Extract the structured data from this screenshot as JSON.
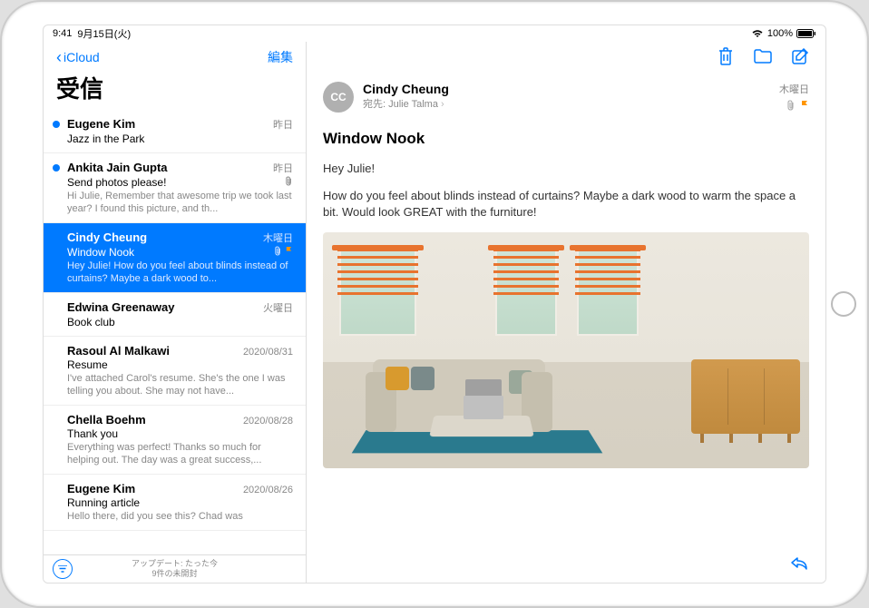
{
  "status": {
    "time": "9:41",
    "date": "9月15日(火)",
    "battery": "100%"
  },
  "sidebar": {
    "back_label": "iCloud",
    "edit_label": "編集",
    "title": "受信",
    "footer_line1": "アップデート: たった今",
    "footer_line2": "9件の未開封"
  },
  "messages": [
    {
      "sender": "Eugene Kim",
      "date": "昨日",
      "subject": "Jazz in the Park",
      "preview": "",
      "unread": true
    },
    {
      "sender": "Ankita Jain Gupta",
      "date": "昨日",
      "subject": "Send photos please!",
      "preview": "Hi Julie, Remember that awesome trip we took last year? I found this picture, and th...",
      "unread": true,
      "attach": true
    },
    {
      "sender": "Cindy Cheung",
      "date": "木曜日",
      "subject": "Window Nook",
      "preview": "Hey Julie! How do you feel about blinds instead of curtains? Maybe a dark wood to...",
      "attach": true,
      "flag": true,
      "selected": true
    },
    {
      "sender": "Edwina Greenaway",
      "date": "火曜日",
      "subject": "Book club",
      "preview": ""
    },
    {
      "sender": "Rasoul Al Malkawi",
      "date": "2020/08/31",
      "subject": "Resume",
      "preview": "I've attached Carol's resume. She's the one I was telling you about. She may not have..."
    },
    {
      "sender": "Chella Boehm",
      "date": "2020/08/28",
      "subject": "Thank you",
      "preview": "Everything was perfect! Thanks so much for helping out. The day was a great success,..."
    },
    {
      "sender": "Eugene Kim",
      "date": "2020/08/26",
      "subject": "Running article",
      "preview": "Hello there, did you see this? Chad was"
    }
  ],
  "detail": {
    "initials": "CC",
    "sender": "Cindy Cheung",
    "recipient_label": "宛先:",
    "recipient_name": "Julie Talma",
    "date": "木曜日",
    "subject": "Window Nook",
    "greeting": "Hey Julie!",
    "body": "How do you feel about blinds instead of curtains? Maybe a dark wood to warm the space a bit. Would look GREAT with the furniture!"
  }
}
